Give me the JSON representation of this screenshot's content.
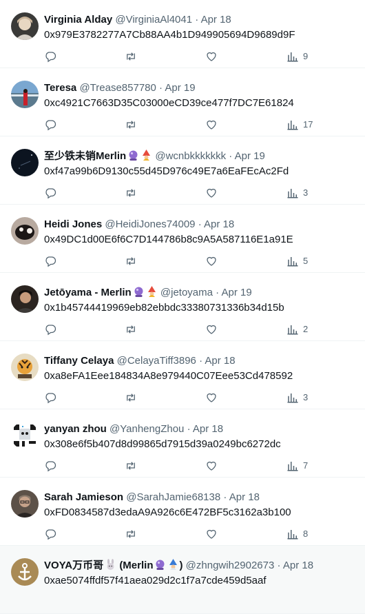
{
  "tweets": [
    {
      "name": "Virginia Alday",
      "handle": "@VirginiaAl4041",
      "date": "Apr 18",
      "text": "0x979E3782277A7Cb88AA4b1D949905694D9689d9F",
      "views": "9"
    },
    {
      "name": "Teresa",
      "handle": "@Trease857780",
      "date": "Apr 19",
      "text": "0xc4921C7663D35C03000eCD39ce477f7DC7E61824",
      "views": "17"
    },
    {
      "name": "至少铁未销Merlin",
      "handle": "@wcnbkkkkkkk",
      "date": "Apr 19",
      "text": "0xf47a99b6D9130c55d45D976c49E7a6EaFEcAc2Fd",
      "views": "3",
      "badges": [
        "crystal-ball",
        "wizard"
      ]
    },
    {
      "name": "Heidi Jones",
      "handle": "@HeidiJones74009",
      "date": "Apr 18",
      "text": "0x49DC1d00E6f6C7D144786b8c9A5A587116E1a91E",
      "views": "5"
    },
    {
      "name": "Jetōyama - Merlin",
      "handle": "@jetoyama",
      "date": "Apr 19",
      "text": "0x1b45744419969eb82ebbdc33380731336b34d15b",
      "views": "2",
      "badges": [
        "crystal-ball",
        "wizard"
      ]
    },
    {
      "name": "Tiffany Celaya",
      "handle": "@CelayaTiff3896",
      "date": "Apr 18",
      "text": "0xa8eFA1Eee184834A8e979440C07Eee53Cd478592",
      "views": "3"
    },
    {
      "name": "yanyan zhou",
      "handle": "@YanhengZhou",
      "date": "Apr 18",
      "text": "0x308e6f5b407d8d99865d7915d39a0249bc6272dc",
      "views": "7"
    },
    {
      "name": "Sarah Jamieson",
      "handle": "@SarahJamie68138",
      "date": "Apr 18",
      "text": "0xFD0834587d3edaA9A926c6E472BF5c3162a3b100",
      "views": "8"
    },
    {
      "name": "VOYA万币哥",
      "name_suffix": "(Merlin",
      "name_close": ")",
      "handle": "@zhngwih2902673",
      "date": "Apr 18",
      "text": "0xae5074ffdf57f41aea029d2c1f7a7cde459d5aaf",
      "views": "",
      "badges": [
        "rabbit",
        "crystal-ball",
        "wizard"
      ]
    }
  ],
  "separator": "·",
  "colors": {
    "text": "#0f1419",
    "secondary": "#536471",
    "border": "#eff3f4",
    "hover": "#f7f9f9"
  }
}
